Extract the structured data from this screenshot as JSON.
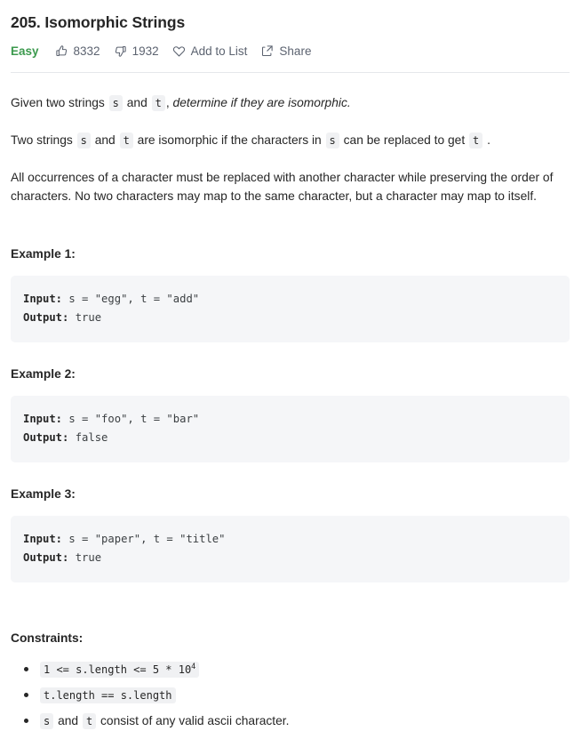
{
  "header": {
    "title": "205. Isomorphic Strings",
    "difficulty": "Easy",
    "difficulty_color": "#3c9a4e",
    "likes": "8332",
    "dislikes": "1932",
    "add_to_list_label": "Add to List",
    "share_label": "Share"
  },
  "description": {
    "p1": {
      "lead": "Given two strings",
      "code_s": "s",
      "and": "and",
      "code_t": "t",
      "comma": ",",
      "emphasis": "determine if they are isomorphic."
    },
    "p2": {
      "lead": "Two strings",
      "code_s1": "s",
      "and": "and",
      "code_t1": "t",
      "mid": "are isomorphic if the characters in",
      "code_s2": "s",
      "tail": "can be replaced to get",
      "code_t2": "t",
      "period": "."
    },
    "p3": "All occurrences of a character must be replaced with another character while preserving the order of characters. No two characters may map to the same character, but a character may map to itself."
  },
  "examples": [
    {
      "heading": "Example 1:",
      "input_label": "Input:",
      "input_value": " s = \"egg\", t = \"add\"",
      "output_label": "Output:",
      "output_value": " true"
    },
    {
      "heading": "Example 2:",
      "input_label": "Input:",
      "input_value": " s = \"foo\", t = \"bar\"",
      "output_label": "Output:",
      "output_value": " false"
    },
    {
      "heading": "Example 3:",
      "input_label": "Input:",
      "input_value": " s = \"paper\", t = \"title\"",
      "output_label": "Output:",
      "output_value": " true"
    }
  ],
  "constraints": {
    "heading": "Constraints:",
    "items": [
      {
        "code_prefix": "1 <= s.length <= 5 * 10",
        "code_sup": "4"
      },
      {
        "code_prefix": "t.length == s.length"
      },
      {
        "code_s": "s",
        "and": "and",
        "code_t": "t",
        "tail": "consist of any valid ascii character."
      }
    ]
  }
}
